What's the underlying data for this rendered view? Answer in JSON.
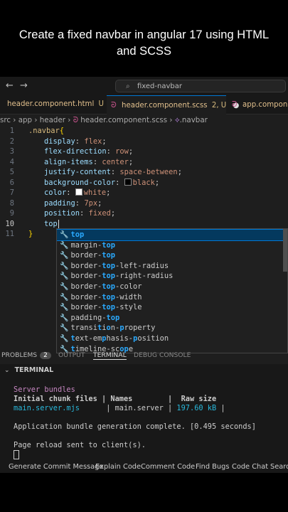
{
  "caption": {
    "line1": "Create a fixed navbar in angular 17 using HTML",
    "line2": "and SCSS"
  },
  "titlebar": {
    "back_glyph": "←",
    "forward_glyph": "→",
    "search_icon_glyph": "⌕",
    "command_center": "fixed-navbar"
  },
  "tabs": [
    {
      "label": "header.component.html",
      "status": "U"
    },
    {
      "label": "header.component.scss",
      "status": "2, U",
      "modified_glyph": "●"
    },
    {
      "label": "app.componen"
    }
  ],
  "sass_icon_glyph": "ᘐ",
  "breadcrumb": {
    "text": "src › app › header › ",
    "file": "header.component.scss",
    "sep": " › ",
    "symbol_glyph": "⟡",
    "symbol": ".navbar"
  },
  "code": {
    "line_numbers": [
      "1",
      "2",
      "3",
      "4",
      "5",
      "6",
      "7",
      "8",
      "9",
      "10",
      "11"
    ],
    "l1_selector": ".navbar",
    "l1_brace": "{",
    "l2_prop": "display",
    "l2_val": "flex",
    "l3_prop": "flex-direction",
    "l3_val": "row",
    "l4_prop": "align-items",
    "l4_val": "center",
    "l5_prop": "justify-content",
    "l5_val": "space-between",
    "l6_prop": "background-color",
    "l6_val": "black",
    "l7_prop": "color",
    "l7_val": "white",
    "l8_prop": "padding",
    "l8_val": "7px",
    "l9_prop": "position",
    "l9_val": "fixed",
    "l10_text": "top",
    "l11_brace": "}"
  },
  "suggestions": [
    {
      "pre": "",
      "match": "top",
      "post": ""
    },
    {
      "pre": "margin-",
      "match": "top",
      "post": ""
    },
    {
      "pre": "border-",
      "match": "top",
      "post": ""
    },
    {
      "pre": "border-",
      "match": "top",
      "post": "-left-radius"
    },
    {
      "pre": "border-",
      "match": "top",
      "post": "-right-radius"
    },
    {
      "pre": "border-",
      "match": "top",
      "post": "-color"
    },
    {
      "pre": "border-",
      "match": "top",
      "post": "-width"
    },
    {
      "pre": "border-",
      "match": "top",
      "post": "-style"
    },
    {
      "pre": "padding-",
      "match": "top",
      "post": ""
    },
    {
      "pre": "transi",
      "match": "t",
      "post": "i",
      "match2": "o",
      "post2": "n-",
      "match3": "p",
      "post3": "roperty"
    },
    {
      "pre": "",
      "match": "t",
      "post": "ext-em",
      "match2": "p",
      "post2": "hasis-",
      "match3": "p",
      "post3": "osition"
    },
    {
      "pre": "",
      "match": "t",
      "post": "imeline-sc",
      "match2": "o",
      "post2": "",
      "match3": "p",
      "post3": "e"
    }
  ],
  "wrench_glyph": "🔧",
  "panel": {
    "problems_label": "PROBLEMS",
    "problems_count": "2",
    "output_label": "OUTPUT",
    "terminal_label": "TERMINAL",
    "debug_label": "DEBUG CONSOLE",
    "terminal_header": "TERMINAL",
    "chevron": "⌄"
  },
  "terminal": {
    "server_bundles": "Server bundles",
    "header_row": "Initial chunk files | Names        |  Raw size",
    "file": "main.server.mjs",
    "row_mid": "      | main.server | ",
    "size": "197.60 kB",
    "row_end": " |",
    "complete": "Application bundle generation complete. [0.495 seconds]",
    "reload": "Page reload sent to client(s)."
  },
  "statusbar": [
    "Generate Commit Message",
    "Explain Code",
    "Comment Code",
    "Find Bugs",
    "Code Chat",
    "Search"
  ]
}
